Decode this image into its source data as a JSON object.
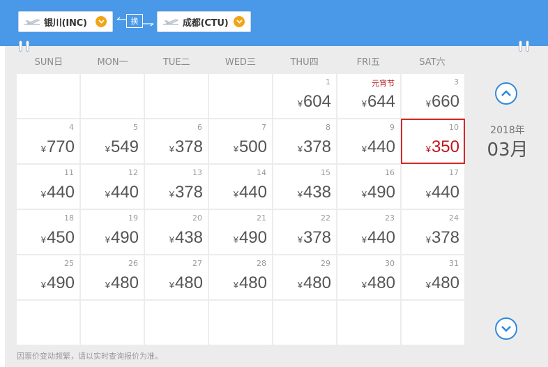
{
  "route": {
    "departure": "银川(INC)",
    "arrival": "成都(CTU)",
    "swap_label": "换"
  },
  "weekdays": [
    "SUN日",
    "MON一",
    "TUE二",
    "WED三",
    "THU四",
    "FRI五",
    "SAT六"
  ],
  "calendar": {
    "year_label": "2018年",
    "month_label": "03月",
    "currency": "¥",
    "selected_day": 10,
    "cells": [
      null,
      null,
      null,
      null,
      {
        "day": "1",
        "price": "604"
      },
      {
        "day": "元宵节",
        "price": "644",
        "holiday": true
      },
      {
        "day": "3",
        "price": "660"
      },
      {
        "day": "4",
        "price": "770"
      },
      {
        "day": "5",
        "price": "549"
      },
      {
        "day": "6",
        "price": "378"
      },
      {
        "day": "7",
        "price": "500"
      },
      {
        "day": "8",
        "price": "378"
      },
      {
        "day": "9",
        "price": "440"
      },
      {
        "day": "10",
        "price": "350"
      },
      {
        "day": "11",
        "price": "440"
      },
      {
        "day": "12",
        "price": "440"
      },
      {
        "day": "13",
        "price": "378"
      },
      {
        "day": "14",
        "price": "440"
      },
      {
        "day": "15",
        "price": "438"
      },
      {
        "day": "16",
        "price": "490"
      },
      {
        "day": "17",
        "price": "440"
      },
      {
        "day": "18",
        "price": "450"
      },
      {
        "day": "19",
        "price": "490"
      },
      {
        "day": "20",
        "price": "438"
      },
      {
        "day": "21",
        "price": "490"
      },
      {
        "day": "22",
        "price": "378"
      },
      {
        "day": "23",
        "price": "440"
      },
      {
        "day": "24",
        "price": "378"
      },
      {
        "day": "25",
        "price": "490"
      },
      {
        "day": "26",
        "price": "480"
      },
      {
        "day": "27",
        "price": "480"
      },
      {
        "day": "28",
        "price": "480"
      },
      {
        "day": "29",
        "price": "480"
      },
      {
        "day": "30",
        "price": "480"
      },
      {
        "day": "31",
        "price": "480"
      },
      null,
      null,
      null,
      null,
      null,
      null,
      null
    ]
  },
  "footer_note": "因票价变动频繁，请以实时查询报价为准。",
  "colors": {
    "header_bg": "#4a99e8",
    "accent_orange": "#f2a417",
    "selected_border": "#d62828",
    "selected_price": "#c0131b",
    "nav_blue": "#3189dd"
  },
  "icons": {
    "plane": "plane-icon",
    "dropdown": "dropdown-arrow-icon",
    "nav_up": "chevron-up-icon",
    "nav_down": "chevron-down-icon",
    "swap": "swap-arrows-icon"
  }
}
